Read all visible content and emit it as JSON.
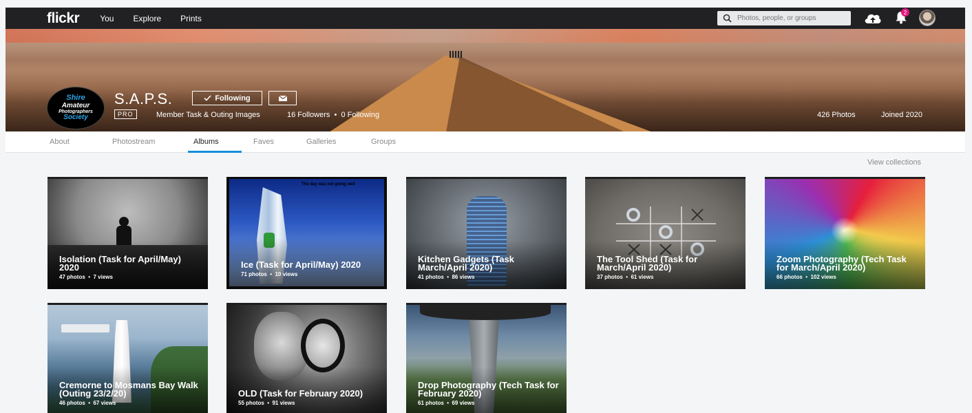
{
  "nav": {
    "logo": "flickr",
    "links": [
      "You",
      "Explore",
      "Prints"
    ],
    "search_placeholder": "Photos, people, or groups",
    "notification_count": "2"
  },
  "profile": {
    "name": "S.A.P.S.",
    "avatar_lines": [
      "Shire",
      "Amateur",
      "Photographers",
      "Society"
    ],
    "following_label": "Following",
    "pro_label": "PRO",
    "description": "Member Task & Outing Images",
    "followers": "16 Followers",
    "following_count": "0 Following",
    "photos": "426 Photos",
    "joined": "Joined 2020"
  },
  "tabs": [
    "About",
    "Photostream",
    "Albums",
    "Faves",
    "Galleries",
    "Groups"
  ],
  "active_tab": "Albums",
  "view_collections": "View collections",
  "albums": [
    {
      "title": "Isolation (Task for April/May) 2020",
      "photos": "47 photos",
      "views": "7 views"
    },
    {
      "title": "Ice (Task for April/May) 2020",
      "photos": "71 photos",
      "views": "10 views",
      "caption": "The day was not going well"
    },
    {
      "title": "Kitchen Gadgets (Task March/April 2020)",
      "photos": "41 photos",
      "views": "86 views"
    },
    {
      "title": "The Tool Shed (Task for March/April 2020)",
      "photos": "37 photos",
      "views": "61 views"
    },
    {
      "title": "Zoom Photography (Tech Task for March/April 2020)",
      "photos": "66 photos",
      "views": "102 views"
    },
    {
      "title": "Cremorne to Mosmans Bay Walk (Outing 23/2/20)",
      "photos": "46 photos",
      "views": "67 views"
    },
    {
      "title": "OLD (Task for February 2020)",
      "photos": "55 photos",
      "views": "91 views"
    },
    {
      "title": "Drop Photography (Tech Task for February 2020)",
      "photos": "61 photos",
      "views": "69 views"
    }
  ],
  "colors": {
    "nav_bg": "#212124",
    "accent": "#128fdc",
    "badge": "#e0177d",
    "page_bg": "#f3f5f6"
  }
}
